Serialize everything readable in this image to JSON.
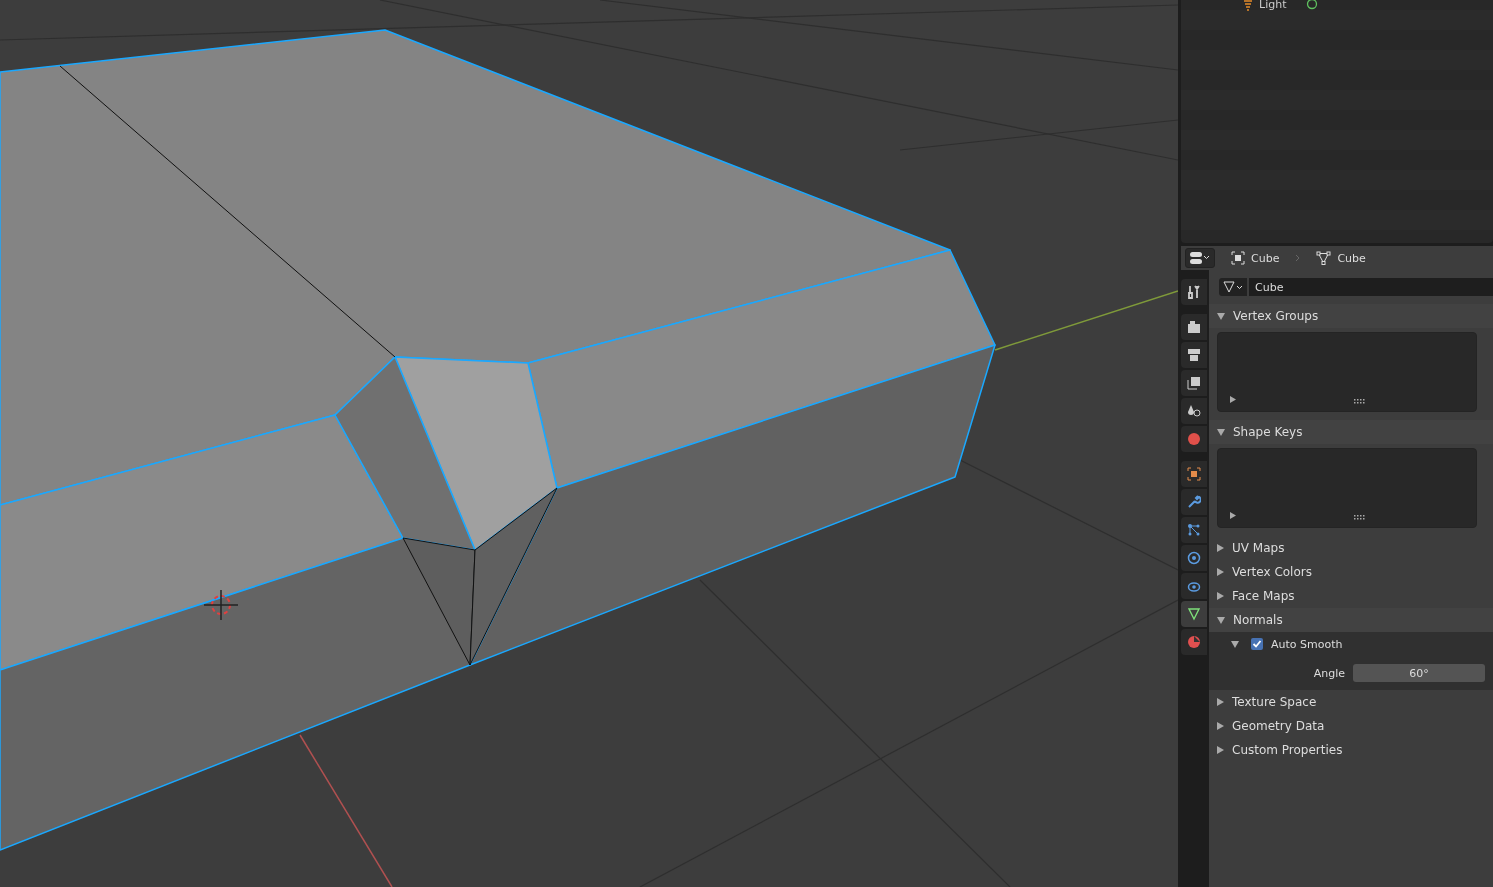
{
  "outliner": {
    "rows": [
      {
        "label": "Light"
      }
    ]
  },
  "properties": {
    "breadcrumb": [
      {
        "kind": "object",
        "label": "Cube"
      },
      {
        "kind": "mesh",
        "label": "Cube"
      }
    ],
    "tabs": [
      {
        "kind": "tool",
        "selected": false
      },
      {
        "kind": "render",
        "selected": false
      },
      {
        "kind": "output",
        "selected": false
      },
      {
        "kind": "view",
        "selected": false
      },
      {
        "kind": "scene",
        "selected": false
      },
      {
        "kind": "world",
        "selected": false
      },
      {
        "kind": "object",
        "selected": false
      },
      {
        "kind": "modifier",
        "selected": false
      },
      {
        "kind": "particles",
        "selected": false
      },
      {
        "kind": "physics",
        "selected": false
      },
      {
        "kind": "constraint",
        "selected": false
      },
      {
        "kind": "data",
        "selected": true
      },
      {
        "kind": "material",
        "selected": false
      }
    ],
    "datablock": {
      "value": "Cube"
    },
    "panels": [
      {
        "title": "Vertex Groups",
        "expanded": true,
        "kind": "list"
      },
      {
        "title": "Shape Keys",
        "expanded": true,
        "kind": "list"
      },
      {
        "title": "UV Maps",
        "expanded": false
      },
      {
        "title": "Vertex Colors",
        "expanded": false
      },
      {
        "title": "Face Maps",
        "expanded": false
      },
      {
        "title": "Normals",
        "expanded": true,
        "kind": "normals",
        "subpanel": {
          "title": "Auto Smooth",
          "expanded": true,
          "checked": true,
          "fields": [
            {
              "label": "Angle",
              "value": "60°"
            }
          ]
        }
      },
      {
        "title": "Texture Space",
        "expanded": false
      },
      {
        "title": "Geometry Data",
        "expanded": false
      },
      {
        "title": "Custom Properties",
        "expanded": false
      }
    ]
  }
}
